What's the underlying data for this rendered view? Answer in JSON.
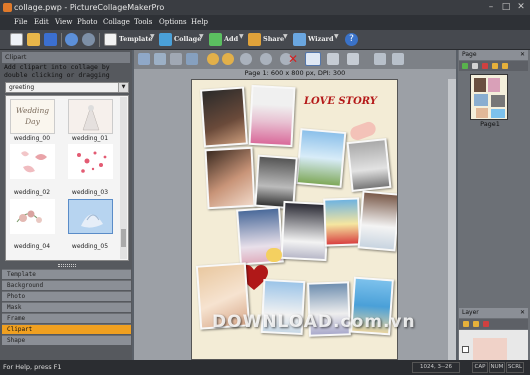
{
  "window": {
    "title": "collage.pwp - PictureCollageMakerPro"
  },
  "menu": [
    "File",
    "Edit",
    "View",
    "Photo",
    "Collage",
    "Tools",
    "Options",
    "Help"
  ],
  "toolbar": {
    "template": "Template",
    "collage": "Collage",
    "add": "Add",
    "share": "Share",
    "wizard": "Wizard"
  },
  "clipart": {
    "title": "Clipart",
    "hint": "Add clipart into collage by double clicking or dragging",
    "category": "greeting",
    "items": [
      "wedding_00",
      "wedding_01",
      "wedding_02",
      "wedding_03",
      "wedding_04",
      "wedding_05"
    ],
    "thumb_text": "Wedding Day"
  },
  "panels": [
    "Template",
    "Background",
    "Photo",
    "Mask",
    "Frame",
    "Clipart",
    "Shape"
  ],
  "active_panel": "Clipart",
  "canvas": {
    "page_info": "Page 1: 600 x 800 px, DPI: 300",
    "art_title": "LOVE STORY"
  },
  "pages": {
    "title": "Page",
    "label": "Page1"
  },
  "layer": {
    "title": "Layer"
  },
  "watermark": "DOWNLOAD.com.vn",
  "status": {
    "help": "For Help, press F1",
    "coords": "1024, 3--26",
    "cap": "CAP",
    "num": "NUM",
    "scrl": "SCRL"
  }
}
